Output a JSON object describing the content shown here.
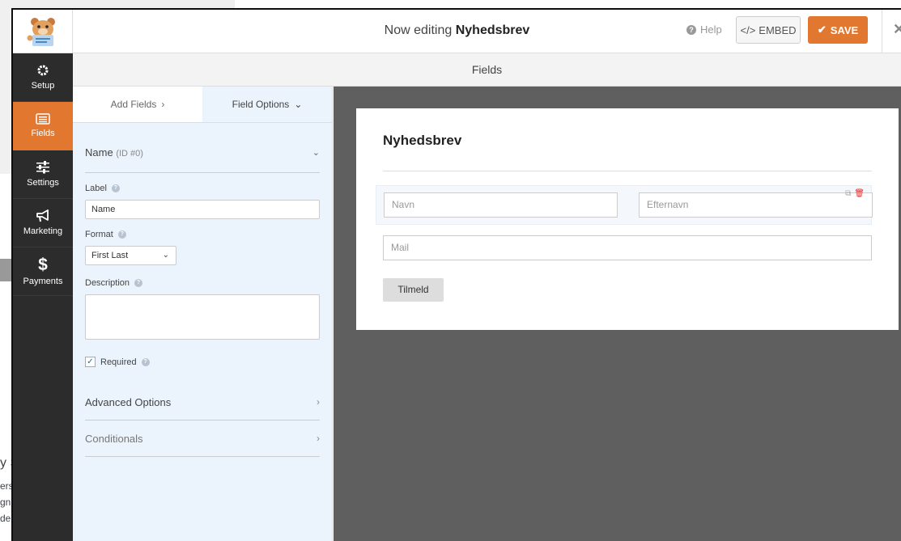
{
  "background": {
    "side_text_1": "y S",
    "side_text_2": "ers",
    "side_text_3": "gn",
    "side_text_4": "de"
  },
  "header": {
    "title_prefix": "Now editing ",
    "title_form": "Nyhedsbrev",
    "help_label": "Help",
    "embed_label": "EMBED",
    "save_label": "SAVE",
    "accent_color": "#e27730"
  },
  "sidebar": {
    "items": [
      {
        "label": "Setup",
        "icon": "gear-icon"
      },
      {
        "label": "Fields",
        "icon": "list-icon"
      },
      {
        "label": "Settings",
        "icon": "sliders-icon"
      },
      {
        "label": "Marketing",
        "icon": "megaphone-icon"
      },
      {
        "label": "Payments",
        "icon": "dollar-icon"
      }
    ],
    "active": "Fields"
  },
  "section_title": "Fields",
  "panel": {
    "tab_add": "Add Fields",
    "tab_options": "Field Options",
    "field_name": "Name",
    "field_id": "(ID #0)",
    "label_label": "Label",
    "label_value": "Name",
    "format_label": "Format",
    "format_value": "First Last",
    "description_label": "Description",
    "description_value": "",
    "required_label": "Required",
    "required_checked": true,
    "advanced_label": "Advanced Options",
    "conditionals_label": "Conditionals"
  },
  "form_preview": {
    "title": "Nyhedsbrev",
    "first_placeholder": "Navn",
    "last_placeholder": "Efternavn",
    "mail_placeholder": "Mail",
    "submit_label": "Tilmeld"
  }
}
